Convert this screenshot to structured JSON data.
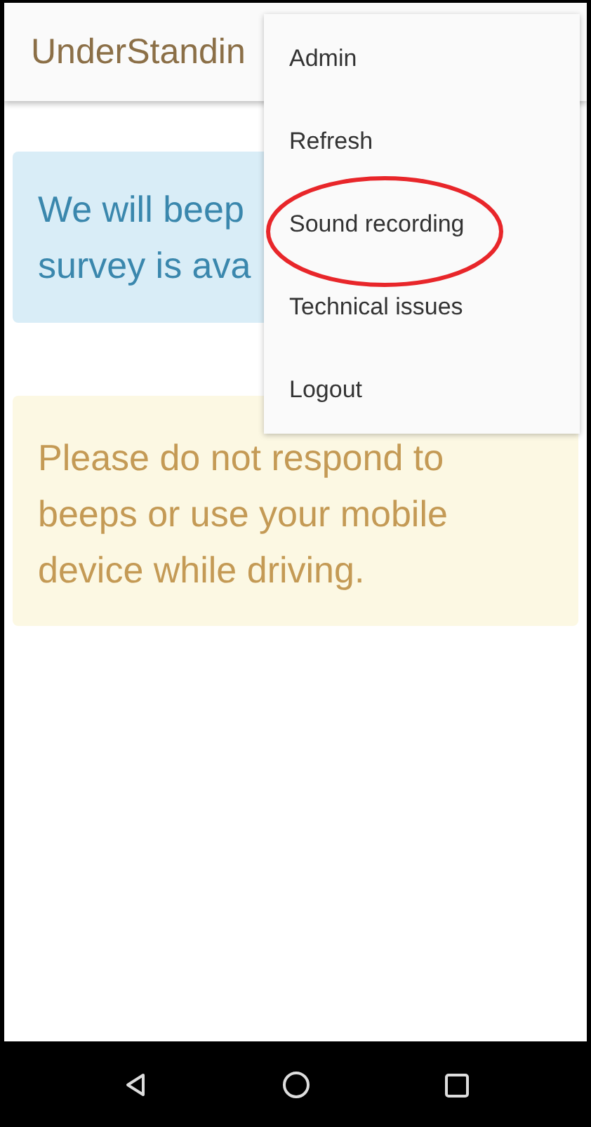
{
  "app_bar": {
    "title": "UnderStandin"
  },
  "cards": [
    {
      "kind": "info",
      "lines": [
        "We will beep",
        "survey is ava"
      ]
    },
    {
      "kind": "warning",
      "lines": [
        "Please do not respond to",
        "beeps or use your mobile",
        "device while driving."
      ]
    }
  ],
  "menu": {
    "items": [
      {
        "label": "Admin",
        "circled": false
      },
      {
        "label": "Refresh",
        "circled": false
      },
      {
        "label": "Sound recording",
        "circled": true
      },
      {
        "label": "Technical issues",
        "circled": false
      },
      {
        "label": "Logout",
        "circled": false
      }
    ]
  },
  "nav_bar": {
    "buttons": [
      {
        "kind": "back"
      },
      {
        "kind": "home"
      },
      {
        "kind": "recents"
      }
    ]
  }
}
